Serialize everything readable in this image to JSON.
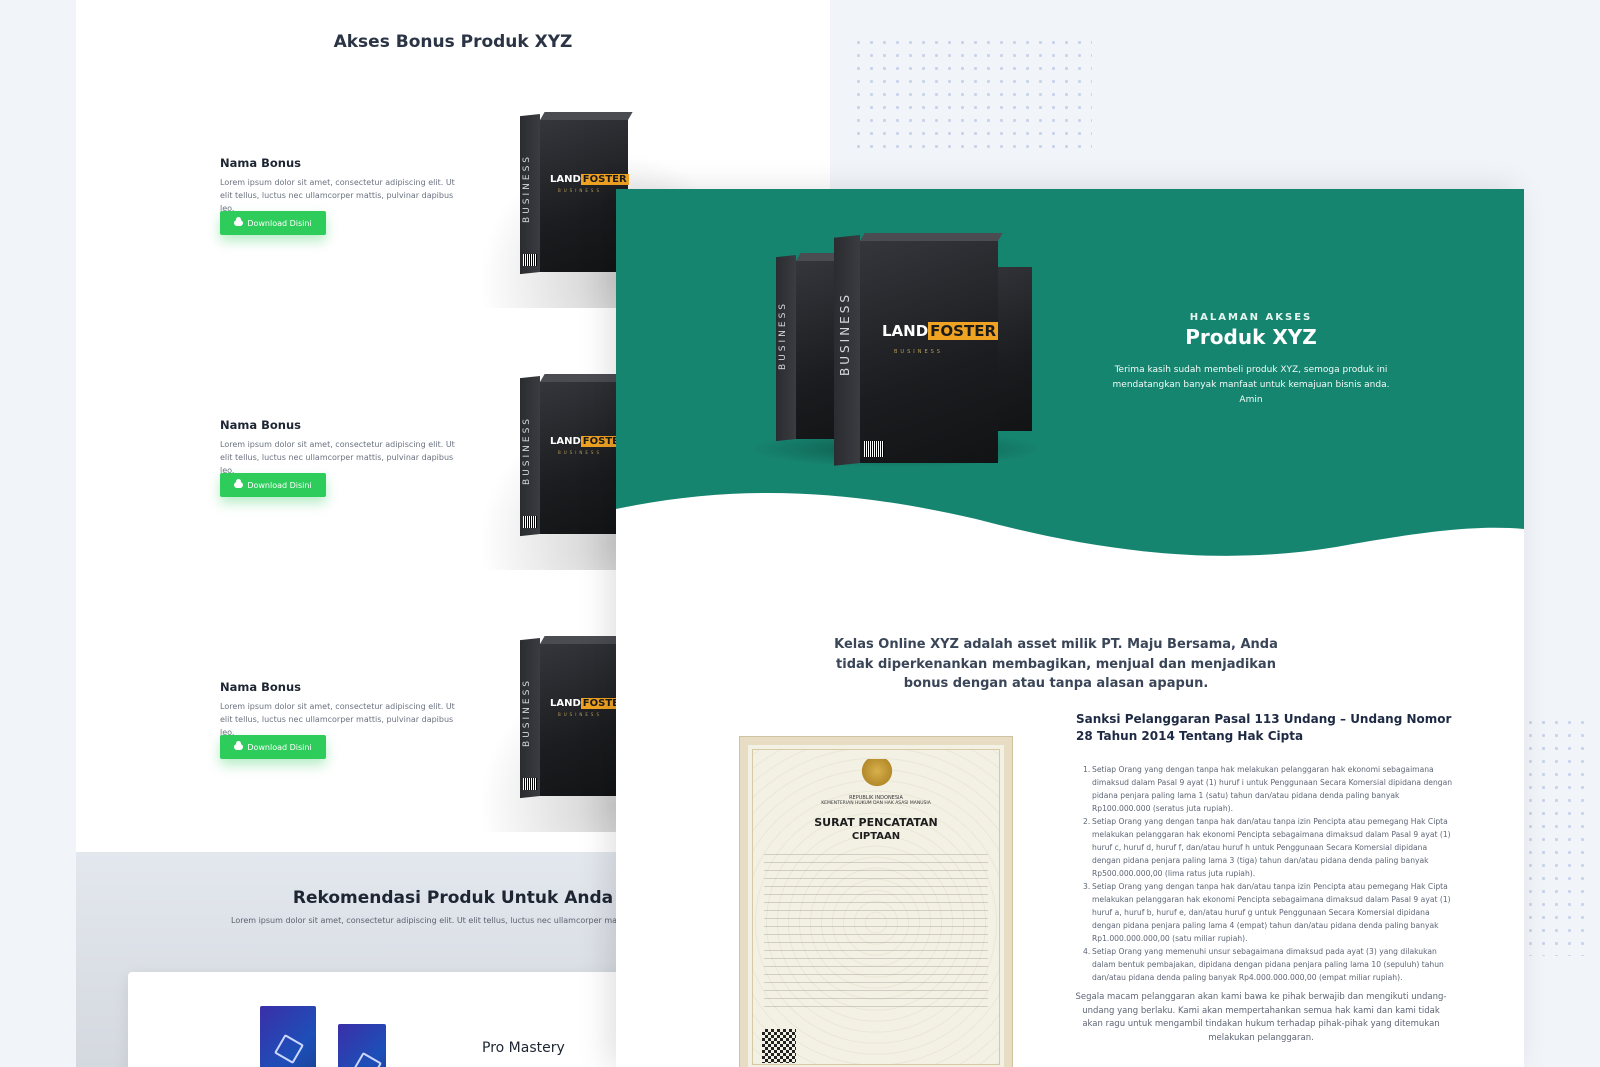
{
  "back_page": {
    "bonus_title": "Akses Bonus Produk XYZ",
    "bonus_items": [
      {
        "name": "Nama Bonus",
        "desc": "Lorem ipsum dolor sit amet, consectetur adipiscing elit. Ut elit tellus, luctus nec ullamcorper mattis, pulvinar dapibus leo.",
        "button": "Download Disini"
      },
      {
        "name": "Nama Bonus",
        "desc": "Lorem ipsum dolor sit amet, consectetur adipiscing elit. Ut elit tellus, luctus nec ullamcorper mattis, pulvinar dapibus leo.",
        "button": "Download Disini"
      },
      {
        "name": "Nama Bonus",
        "desc": "Lorem ipsum dolor sit amet, consectetur adipiscing elit. Ut elit tellus, luctus nec ullamcorper mattis, pulvinar dapibus leo.",
        "button": "Download Disini"
      }
    ],
    "product_box": {
      "vertical": "BUSINESS",
      "logo_a": "LAND",
      "logo_b": "FOSTER",
      "sub": "BUSINESS"
    },
    "recommendation": {
      "title": "Rekomendasi Produk Untuk Anda",
      "desc": "Lorem ipsum dolor sit amet, consectetur adipiscing elit. Ut elit tellus, luctus nec ullamcorper mattis, pulvi",
      "product_name": "Pro Mastery"
    }
  },
  "front_page": {
    "hero": {
      "kicker": "HALAMAN AKSES",
      "title": "Produk XYZ",
      "text": "Terima kasih sudah membeli produk XYZ, semoga produk ini mendatangkan banyak manfaat untuk kemajuan bisnis anda. Amin"
    },
    "notice": "Kelas Online XYZ adalah asset milik PT. Maju Bersama, Anda tidak diperkenankan membagikan, menjual dan menjadikan bonus dengan atau tanpa alasan apapun.",
    "certificate": {
      "country": "REPUBLIK INDONESIA",
      "ministry": "KEMENTERIAN HUKUM DAN HAK ASASI MANUSIA",
      "title_1": "SURAT PENCATATAN",
      "title_2": "CIPTAAN"
    },
    "sanksi": {
      "title": "Sanksi Pelanggaran Pasal 113 Undang – Undang Nomor 28 Tahun 2014 Tentang Hak Cipta",
      "items": [
        {
          "num": "1.",
          "text": "Setiap Orang yang dengan tanpa hak melakukan pelanggaran hak ekonomi sebagaimana dimaksud dalam Pasal 9 ayat (1) huruf i untuk Penggunaan Secara Komersial dipidana dengan pidana penjara paling lama 1 (satu) tahun dan/atau pidana denda paling banyak Rp100.000.000 (seratus juta rupiah)."
        },
        {
          "num": "2.",
          "text": "Setiap Orang yang dengan tanpa hak dan/atau tanpa izin Pencipta atau pemegang Hak Cipta melakukan pelanggaran hak ekonomi Pencipta sebagaimana dimaksud dalam Pasal 9 ayat (1) huruf c, huruf d, huruf f, dan/atau huruf h untuk Penggunaan Secara Komersial dipidana dengan pidana penjara paling lama 3 (tiga) tahun dan/atau pidana denda paling banyak Rp500.000.000,00 (lima ratus juta rupiah)."
        },
        {
          "num": "3.",
          "text": "Setiap Orang yang dengan tanpa hak dan/atau tanpa izin Pencipta atau pemegang Hak Cipta melakukan pelanggaran hak ekonomi Pencipta sebagaimana dimaksud dalam Pasal 9 ayat (1) huruf a, huruf b, huruf e, dan/atau huruf g untuk Penggunaan Secara Komersial dipidana dengan pidana penjara paling lama 4 (empat) tahun dan/atau pidana denda paling banyak Rp1.000.000.000,00 (satu miliar rupiah)."
        },
        {
          "num": "4.",
          "text": "Setiap Orang yang memenuhi unsur sebagaimana dimaksud pada ayat (3) yang dilakukan dalam bentuk pembajakan, dipidana dengan pidana penjara paling lama 10 (sepuluh) tahun dan/atau pidana denda paling banyak Rp4.000.000.000,00 (empat miliar rupiah)."
        }
      ],
      "closing": "Segala macam pelanggaran akan kami bawa ke pihak berwajib dan mengikuti undang-undang yang berlaku. Kami akan mempertahankan semua hak kami dan kami tidak akan ragu untuk mengambil tindakan hukum terhadap pihak-pihak yang ditemukan melakukan pelanggaran."
    }
  },
  "colors": {
    "hero_green": "#168570",
    "download_green": "#2ecc5b",
    "box_accent": "#f0a323"
  }
}
